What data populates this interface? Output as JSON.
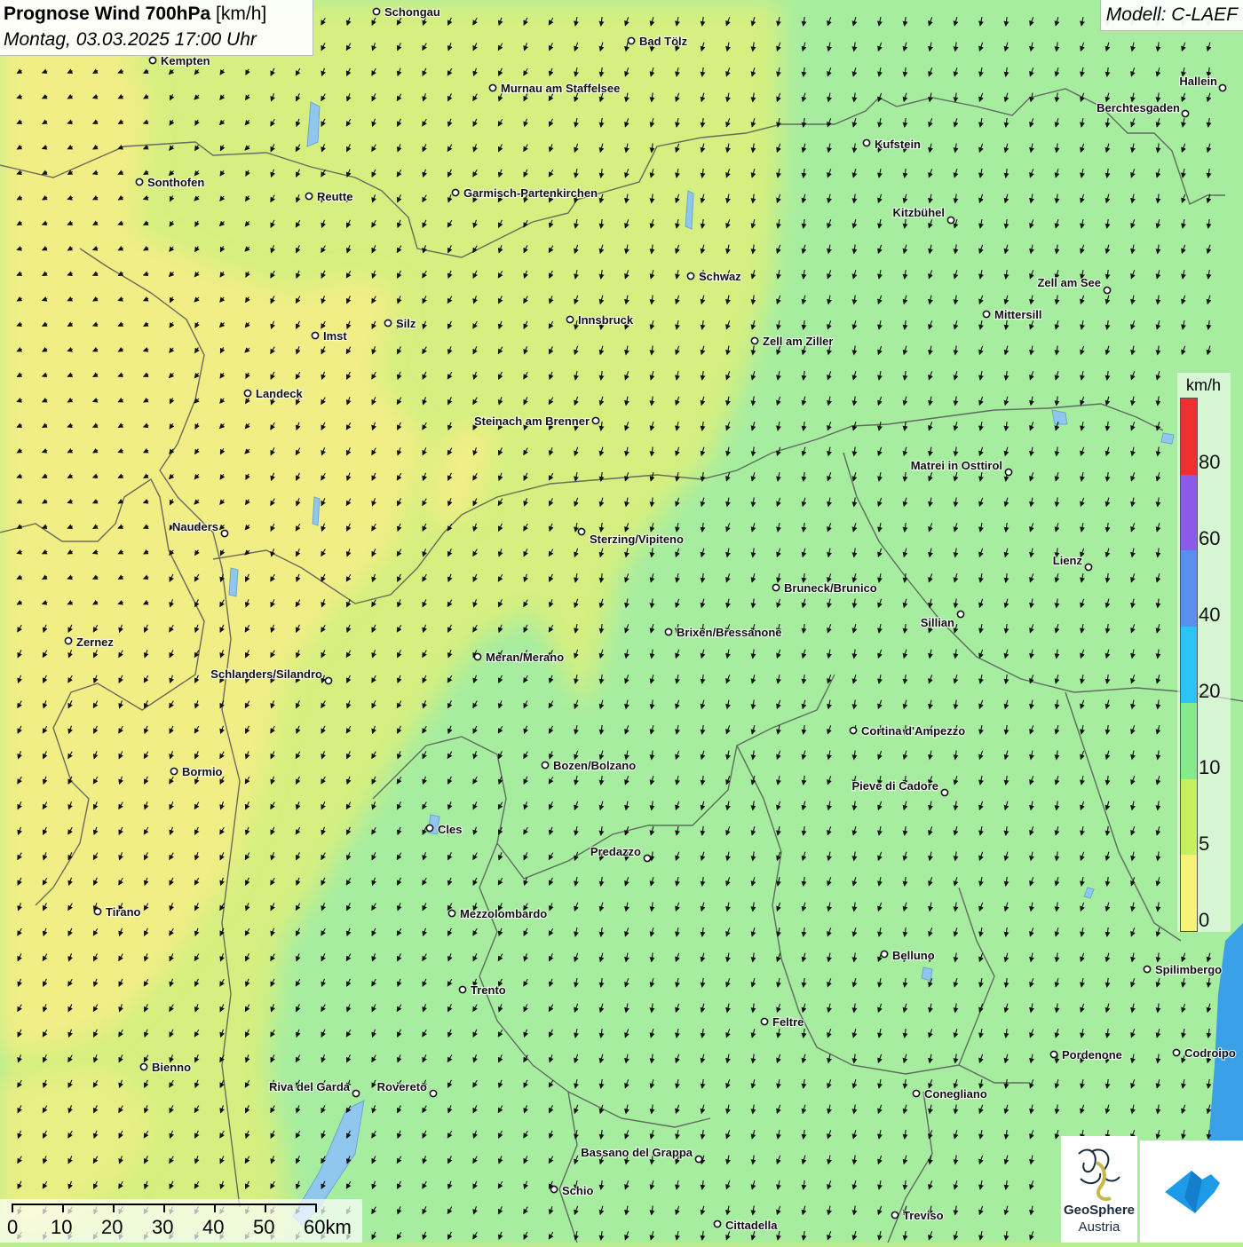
{
  "header": {
    "title_bold": "Prognose Wind 700hPa",
    "title_unit": "[km/h]",
    "datetime": "Montag, 03.03.2025 17:00 Uhr",
    "model": "Modell: C-LAEF"
  },
  "legend": {
    "unit": "km/h",
    "labels": [
      "80",
      "60",
      "40",
      "20",
      "10",
      "5",
      "0"
    ],
    "colors": [
      "#f03030",
      "#8c5ae8",
      "#5a8ff0",
      "#2cc4f4",
      "#86ea8a",
      "#c6f060",
      "#f6f27a"
    ]
  },
  "scale": {
    "labels": [
      "0",
      "10",
      "20",
      "30",
      "40",
      "50",
      "60km"
    ]
  },
  "logo": {
    "text_line1": "GeoSphere",
    "text_line2": "Austria"
  },
  "colors": {
    "yellow": "#f3ee8a",
    "yellow_green": "#d6ef7e",
    "green": "#a6eda0",
    "border": "#555555"
  },
  "cities": [
    {
      "name": "Schongau"
    },
    {
      "name": "Kempten"
    },
    {
      "name": "Bad Tölz"
    },
    {
      "name": "Murnau am Staffelsee"
    },
    {
      "name": "Hallein"
    },
    {
      "name": "Berchtesgaden"
    },
    {
      "name": "Kufstein"
    },
    {
      "name": "Sonthofen"
    },
    {
      "name": "Reutte"
    },
    {
      "name": "Garmisch-Partenkirchen"
    },
    {
      "name": "Kitzbühel"
    },
    {
      "name": "Schwaz"
    },
    {
      "name": "Zell am See"
    },
    {
      "name": "Mittersill"
    },
    {
      "name": "Innsbruck"
    },
    {
      "name": "Silz"
    },
    {
      "name": "Imst"
    },
    {
      "name": "Zell am Ziller"
    },
    {
      "name": "Landeck"
    },
    {
      "name": "Steinach am Brenner"
    },
    {
      "name": "Matrei in Osttirol"
    },
    {
      "name": "Nauders"
    },
    {
      "name": "Sterzing/Vipiteno"
    },
    {
      "name": "Lienz"
    },
    {
      "name": "Bruneck/Brunico"
    },
    {
      "name": "Sillian"
    },
    {
      "name": "Brixen/Bressanone"
    },
    {
      "name": "Zernez"
    },
    {
      "name": "Meran/Merano"
    },
    {
      "name": "Schlanders/Silandro"
    },
    {
      "name": "Cortina d'Ampezzo"
    },
    {
      "name": "Bozen/Bolzano"
    },
    {
      "name": "Bormio"
    },
    {
      "name": "Pieve di Cadore"
    },
    {
      "name": "Cles"
    },
    {
      "name": "Predazzo"
    },
    {
      "name": "Tirano"
    },
    {
      "name": "Mezzolombardo"
    },
    {
      "name": "Belluno"
    },
    {
      "name": "Spilimbergo"
    },
    {
      "name": "Trento"
    },
    {
      "name": "Feltre"
    },
    {
      "name": "Pordenone"
    },
    {
      "name": "Codroipo"
    },
    {
      "name": "Bienno"
    },
    {
      "name": "Riva del Garda"
    },
    {
      "name": "Rovereto"
    },
    {
      "name": "Conegliano"
    },
    {
      "name": "Bassano del Grappa"
    },
    {
      "name": "Schio"
    },
    {
      "name": "Treviso"
    },
    {
      "name": "Cittadella"
    }
  ]
}
